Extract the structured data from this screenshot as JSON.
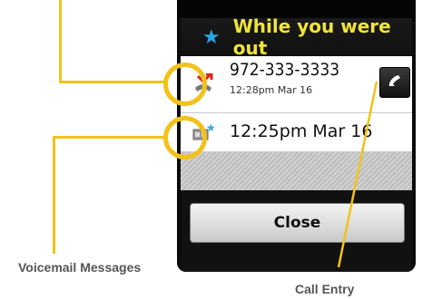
{
  "header": {
    "title": "While you were out",
    "star_icon": "star-icon"
  },
  "calls": [
    {
      "number": "972-333-3333",
      "time": "12:28pm Mar 16",
      "icon": "missed-call-icon"
    }
  ],
  "voicemails": [
    {
      "time": "12:25pm Mar 16",
      "icon": "voicemail-icon"
    }
  ],
  "buttons": {
    "close": "Close"
  },
  "annotations": {
    "voicemail": "Voicemail Messages",
    "call_entry": "Call Entry"
  },
  "colors": {
    "accent": "#f2c21b",
    "title": "#f0e43a",
    "star": "#28a7e6"
  }
}
